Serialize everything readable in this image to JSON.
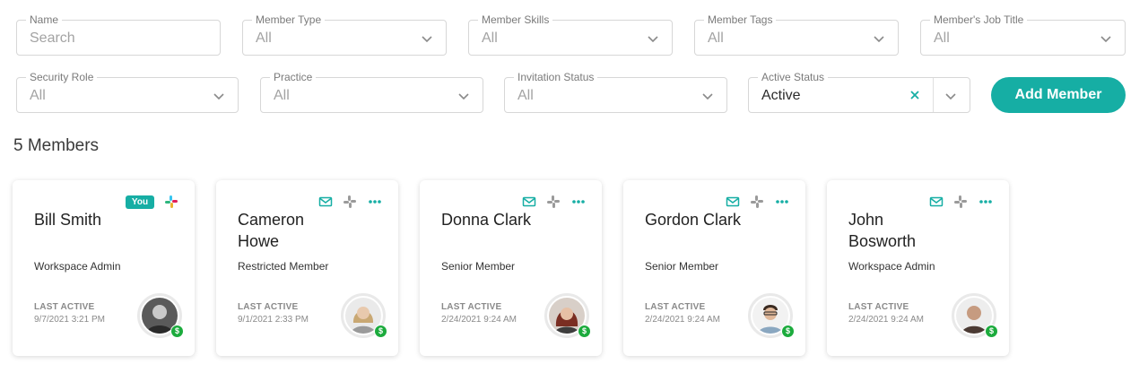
{
  "filters": {
    "name": {
      "label": "Name",
      "placeholder": "Search"
    },
    "member_type": {
      "label": "Member Type",
      "value": "All"
    },
    "member_skills": {
      "label": "Member Skills",
      "value": "All"
    },
    "member_tags": {
      "label": "Member Tags",
      "value": "All"
    },
    "job_title": {
      "label": "Member's Job Title",
      "value": "All"
    },
    "security_role": {
      "label": "Security Role",
      "value": "All"
    },
    "practice": {
      "label": "Practice",
      "value": "All"
    },
    "invitation_status": {
      "label": "Invitation Status",
      "value": "All"
    },
    "active_status": {
      "label": "Active Status",
      "value": "Active"
    }
  },
  "add_member_label": "Add Member",
  "member_count": "5 Members",
  "colors": {
    "accent": "#16aea4",
    "billing_badge": "#1cab3d"
  },
  "members": [
    {
      "name": "Bill Smith",
      "role": "Workspace Admin",
      "last_active_label": "LAST ACTIVE",
      "last_active": "9/7/2021 3:21 PM",
      "you_badge": "You",
      "icons": [
        "slack-color-icon"
      ]
    },
    {
      "name": "Cameron Howe",
      "role": "Restricted Member",
      "last_active_label": "LAST ACTIVE",
      "last_active": "9/1/2021 2:33 PM",
      "icons": [
        "mail-icon",
        "slack-icon",
        "more-icon"
      ]
    },
    {
      "name": "Donna Clark",
      "role": "Senior Member",
      "last_active_label": "LAST ACTIVE",
      "last_active": "2/24/2021 9:24 AM",
      "icons": [
        "mail-icon",
        "slack-icon",
        "more-icon"
      ]
    },
    {
      "name": "Gordon Clark",
      "role": "Senior Member",
      "last_active_label": "LAST ACTIVE",
      "last_active": "2/24/2021 9:24 AM",
      "icons": [
        "mail-icon",
        "slack-icon",
        "more-icon"
      ]
    },
    {
      "name": "John Bosworth",
      "role": "Workspace Admin",
      "last_active_label": "LAST ACTIVE",
      "last_active": "2/24/2021 9:24 AM",
      "icons": [
        "mail-icon",
        "slack-icon",
        "more-icon"
      ]
    }
  ],
  "billing_badge_symbol": "$"
}
